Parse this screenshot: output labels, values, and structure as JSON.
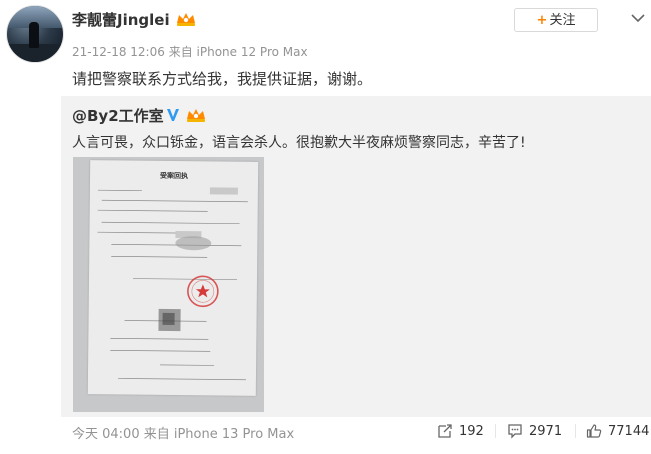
{
  "post": {
    "author": "李靓蕾Jinglei",
    "timestamp": "21-12-18 12:06",
    "source": "来自 iPhone 12 Pro Max",
    "follow_label": "关注",
    "text": "请把警察联系方式给我，我提供证据，谢谢。"
  },
  "repost": {
    "author": "@By2工作室",
    "text": "人言可畏，众口铄金，语言会杀人。很抱歉大半夜麻烦警察同志，辛苦了!",
    "document_title": "受案回执"
  },
  "footer": {
    "time_source": "今天 04:00 来自 iPhone 13 Pro Max",
    "reposts": "192",
    "comments": "2971",
    "likes": "77144"
  },
  "colors": {
    "accent_orange": "#ff8200",
    "verified_blue": "#2e9bf0",
    "meta_gray": "#939393",
    "repost_bg": "#f2f2f2"
  },
  "icons": [
    "vip-badge-icon",
    "chevron-down-icon",
    "verified-icon",
    "repost-icon",
    "comment-icon",
    "like-icon"
  ]
}
